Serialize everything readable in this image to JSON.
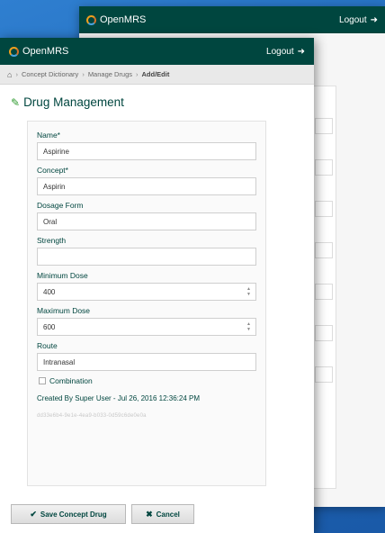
{
  "background_window": {
    "brand": "OpenMRS",
    "logout_label": "Logout"
  },
  "window": {
    "brand": "OpenMRS",
    "logout_label": "Logout"
  },
  "breadcrumb": {
    "home_icon": "home-icon",
    "items": [
      "Concept Dictionary",
      "Manage Drugs",
      "Add/Edit"
    ]
  },
  "page": {
    "title": "Drug Management"
  },
  "form": {
    "name": {
      "label": "Name*",
      "value": "Aspirine"
    },
    "concept": {
      "label": "Concept*",
      "value": "Aspirin"
    },
    "dosage_form": {
      "label": "Dosage Form",
      "value": "Oral"
    },
    "strength": {
      "label": "Strength",
      "value": ""
    },
    "minimum_dose": {
      "label": "Minimum Dose",
      "value": "400"
    },
    "maximum_dose": {
      "label": "Maximum Dose",
      "value": "600"
    },
    "route": {
      "label": "Route",
      "value": "Intranasal"
    },
    "combination": {
      "label": "Combination",
      "checked": false
    },
    "created_by": "Created By Super User - Jul 26, 2016 12:36:24 PM",
    "uuid": "dd33e6b4-9e1e-4ea9-b033-0d59c6de0e0a"
  },
  "actions": {
    "save_label": "Save Concept Drug",
    "cancel_label": "Cancel"
  },
  "colors": {
    "header": "#00463f",
    "accent": "#2e9a2e",
    "desktop": "#1f66b8"
  }
}
